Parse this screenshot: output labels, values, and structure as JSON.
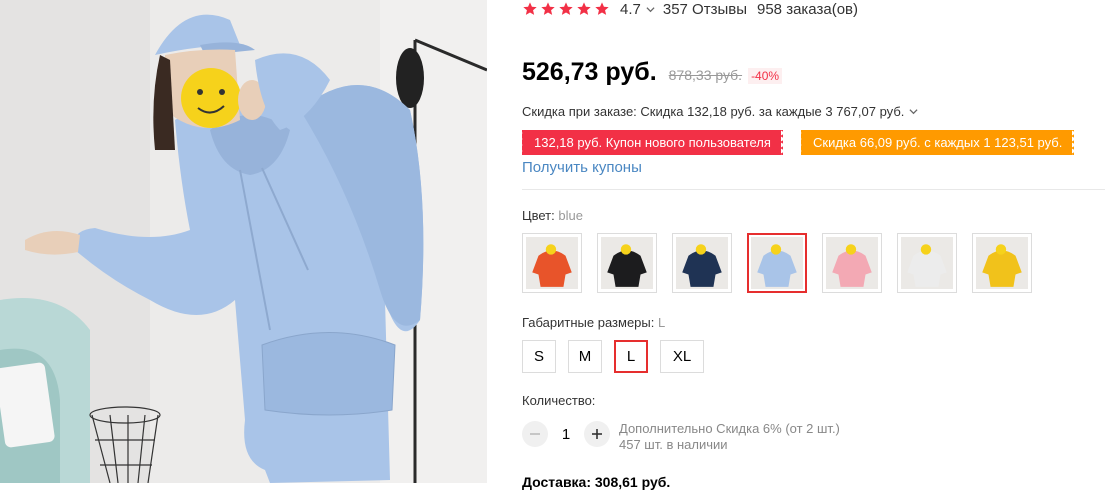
{
  "rating": {
    "value": "4.7",
    "reviews": "357 Отзывы",
    "orders": "958 заказа(ов)",
    "stars_filled": 5
  },
  "price": {
    "current": "526,73 руб.",
    "old": "878,33 руб.",
    "discount": "-40%"
  },
  "order_discount": {
    "text": "Скидка при заказе: Скидка 132,18 руб. за каждые 3 767,07 руб."
  },
  "coupons": {
    "new_user": "132,18 руб. Купон нового пользователя",
    "store": "Скидка 66,09 руб. с каждых 1 123,51 руб.",
    "get_link": "Получить купоны"
  },
  "color": {
    "label": "Цвет:",
    "value": "blue",
    "options": [
      {
        "name": "orange",
        "hex": "#e8542a"
      },
      {
        "name": "black",
        "hex": "#1c1c1e"
      },
      {
        "name": "navy",
        "hex": "#1f3354"
      },
      {
        "name": "blue",
        "hex": "#a9c4e8"
      },
      {
        "name": "pink",
        "hex": "#f3a9b4"
      },
      {
        "name": "white",
        "hex": "#ececec"
      },
      {
        "name": "yellow",
        "hex": "#f1c21b"
      }
    ],
    "selected_index": 3
  },
  "size": {
    "label": "Габаритные размеры:",
    "value": "L",
    "options": [
      "S",
      "M",
      "L",
      "XL"
    ],
    "selected_index": 2
  },
  "quantity": {
    "label": "Количество:",
    "value": "1",
    "extra_discount": "Дополнительно Скидка 6% (от 2 шт.)",
    "stock": "457 шт. в наличии"
  },
  "delivery_partial": "Доставка: 308,61 руб.",
  "colors": {
    "accent": "#f23046",
    "orange": "#ff9a00",
    "link": "#4a87c2",
    "selected_border": "#e62e2e"
  }
}
